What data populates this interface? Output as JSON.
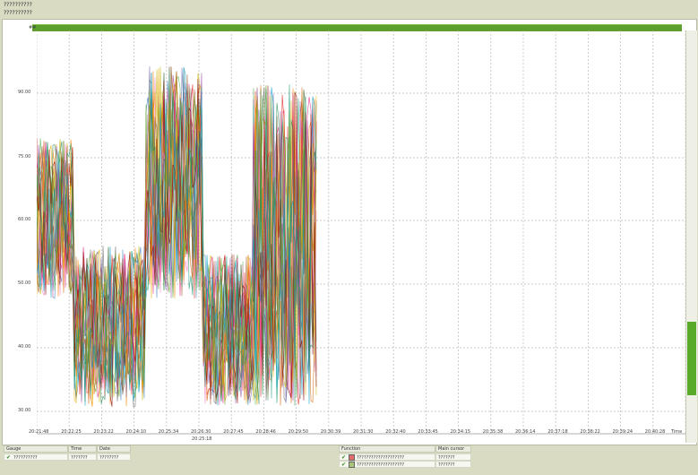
{
  "header": {
    "line1": "??????????",
    "line2": "??????????"
  },
  "chart_data": {
    "type": "line",
    "y_top_label": "##",
    "yticks": [
      "90.00",
      "75.00",
      "60.00",
      "50.00",
      "40.00",
      "30.00"
    ],
    "xticks": [
      "20:21:48",
      "20:22:25",
      "20:23:22",
      "20:24:10",
      "20:25:34",
      "20:26:30",
      "20:27:45",
      "20:28:46",
      "20:29:50",
      "20:30:39",
      "20:31:30",
      "20:32:40",
      "20:33:45",
      "20:34:15",
      "20:35:38",
      "20:36:14",
      "20:37:18",
      "20:38:22",
      "20:39:24",
      "20:40:28"
    ],
    "xtick_extra": "20:25:18",
    "x_axis_end_label": "Time",
    "ylim": [
      27,
      97
    ],
    "grid": true,
    "series_colors": [
      "#e41a1c",
      "#377eb8",
      "#4daf4a",
      "#984ea3",
      "#ff7f00",
      "#c8b400",
      "#a65628",
      "#f781bf",
      "#666666",
      "#1b9e77",
      "#d95f02",
      "#7570b3",
      "#e7298a",
      "#66a61e",
      "#e6ab02",
      "#00a0c6",
      "#8b0000",
      "#2e8b57"
    ]
  },
  "table_left": {
    "headers": [
      "Gauge",
      "Time",
      "Date"
    ],
    "rows": [
      [
        "??????????",
        "???????",
        "????????"
      ]
    ]
  },
  "table_right": {
    "headers": [
      "Function",
      "Main cursor"
    ],
    "rows": [
      {
        "name": "????????????????????",
        "value": "???????",
        "swatch": "#e56a6a"
      },
      {
        "name": "????????????????????",
        "value": "???????",
        "swatch": "#a8c57a"
      }
    ]
  }
}
